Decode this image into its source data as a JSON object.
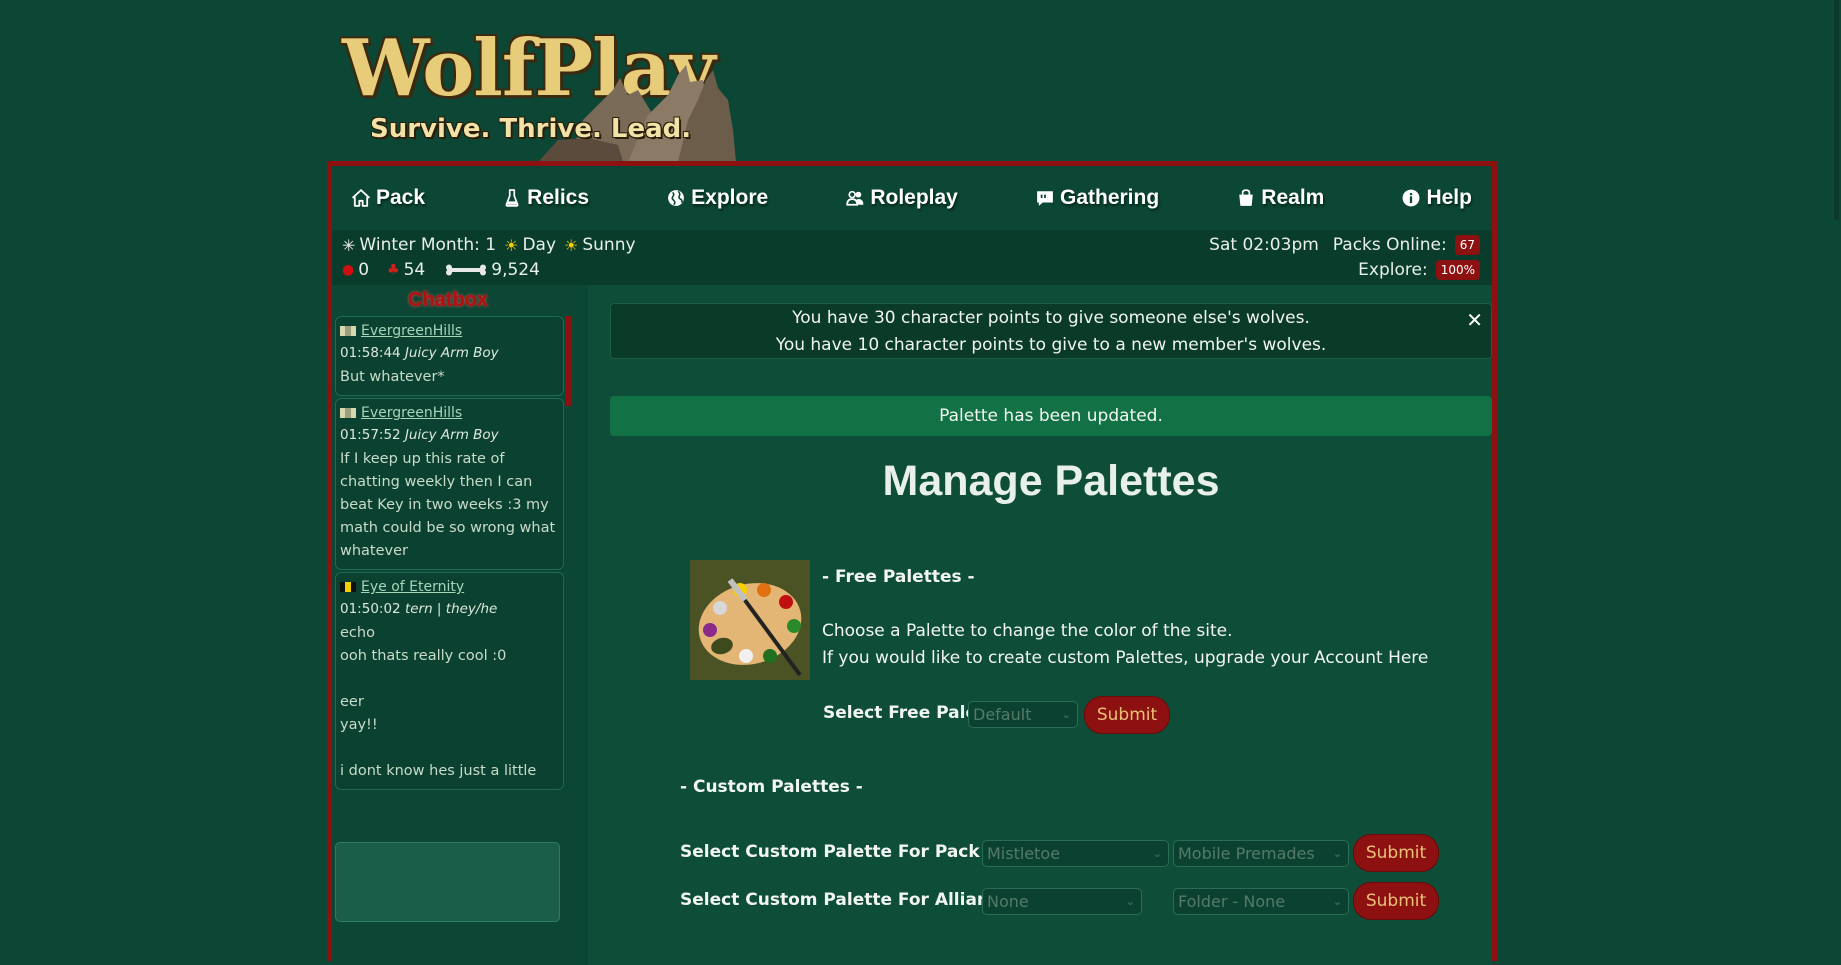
{
  "logo": {
    "title": "WolfPlay",
    "tagline": "Survive. Thrive. Lead."
  },
  "nav": {
    "items": [
      {
        "label": "Pack",
        "icon": "house-icon"
      },
      {
        "label": "Relics",
        "icon": "flask-icon"
      },
      {
        "label": "Explore",
        "icon": "globe-icon"
      },
      {
        "label": "Roleplay",
        "icon": "people-icon"
      },
      {
        "label": "Gathering",
        "icon": "chat-quote-icon"
      },
      {
        "label": "Realm",
        "icon": "bag-icon"
      },
      {
        "label": "Help",
        "icon": "info-icon"
      }
    ]
  },
  "status": {
    "season": "Winter Month: 1",
    "time_of_day": "Day",
    "weather": "Sunny",
    "clock": "Sat 02:03pm",
    "packs_online_label": "Packs Online:",
    "packs_online": "67",
    "apples": "0",
    "mushrooms": "54",
    "bones": "9,524",
    "explore_label": "Explore:",
    "explore_value": "100%"
  },
  "chat": {
    "title": "Chatbox",
    "messages": [
      {
        "user": "EvergreenHills",
        "time": "01:58:44",
        "character": "Juicy Arm Boy",
        "text": "But whatever*"
      },
      {
        "user": "EvergreenHills",
        "time": "01:57:52",
        "character": "Juicy Arm Boy",
        "text": "If I keep up this rate of chatting weekly then I can beat Key in two weeks :3 my math could be so wrong what whatever"
      },
      {
        "user": "Eye of Eternity",
        "time": "01:50:02",
        "character": "tern | they/he",
        "text": "echo\nooh thats really cool :0\n\neer\nyay!!\n\ni dont know hes just a little"
      }
    ]
  },
  "notice": {
    "line1": "You have 30 character points to give someone else's wolves.",
    "line2": "You have 10 character points to give to a new member's wolves.",
    "close": "✕"
  },
  "success": "Palette has been updated.",
  "page_title": "Manage Palettes",
  "free": {
    "heading": "- Free Palettes -",
    "desc1": "Choose a Palette to change the color of the site.",
    "desc2": "If you would like to create custom Palettes, upgrade your Account Here",
    "select_label": "Select Free Palette",
    "select_value": "Default",
    "submit": "Submit"
  },
  "custom": {
    "heading": "- Custom Palettes -",
    "pack_label": "Select Custom Palette For Pack",
    "pack_value": "Mistletoe",
    "pack_folder": "Mobile Premades",
    "alliance_label": "Select Custom Palette For Alliance",
    "alliance_value": "None",
    "alliance_folder": "Folder - None",
    "submit": "Submit"
  },
  "colors": {
    "background": "#0c4634",
    "frame": "#8d1111",
    "success": "#137245",
    "accent_text": "#e9c27a"
  }
}
